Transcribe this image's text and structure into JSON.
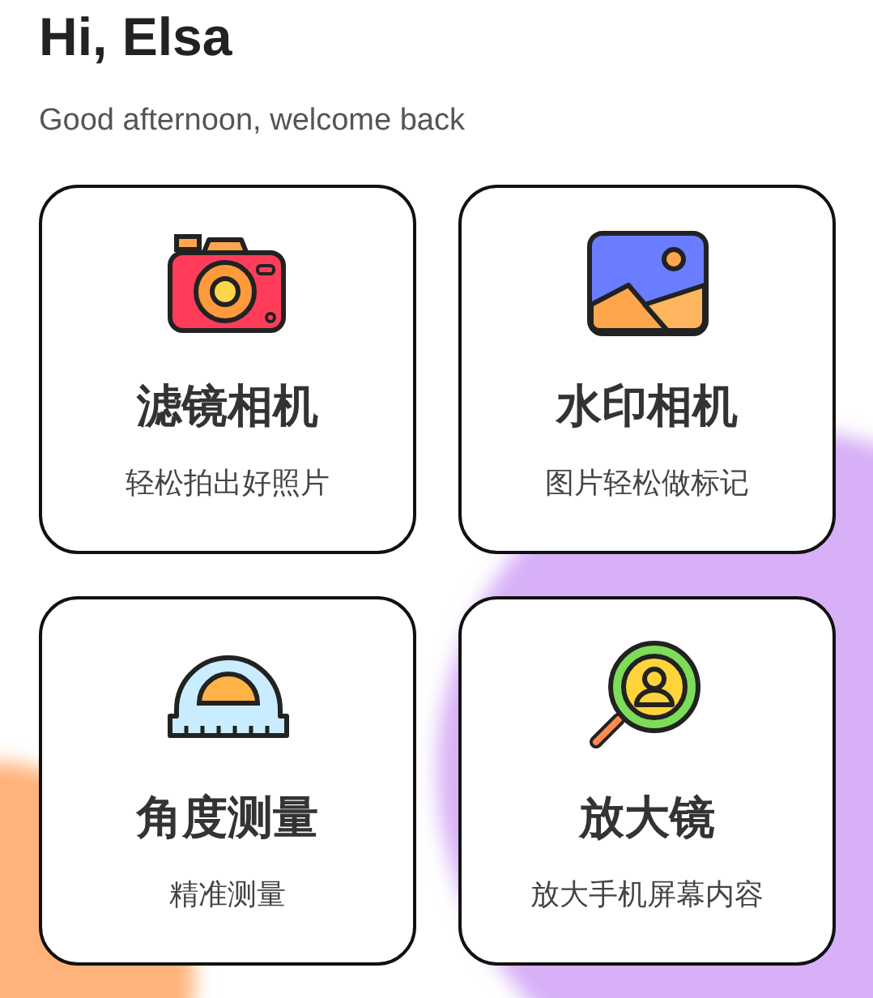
{
  "greeting": "Hi, Elsa",
  "subtitle": "Good afternoon, welcome back",
  "tools": [
    {
      "kind": "camera",
      "title": "滤镜相机",
      "desc": "轻松拍出好照片"
    },
    {
      "kind": "picture",
      "title": "水印相机",
      "desc": "图片轻松做标记"
    },
    {
      "kind": "protractor",
      "title": "角度测量",
      "desc": "精准测量"
    },
    {
      "kind": "magnifier",
      "title": "放大镜",
      "desc": "放大手机屏幕内容"
    }
  ]
}
